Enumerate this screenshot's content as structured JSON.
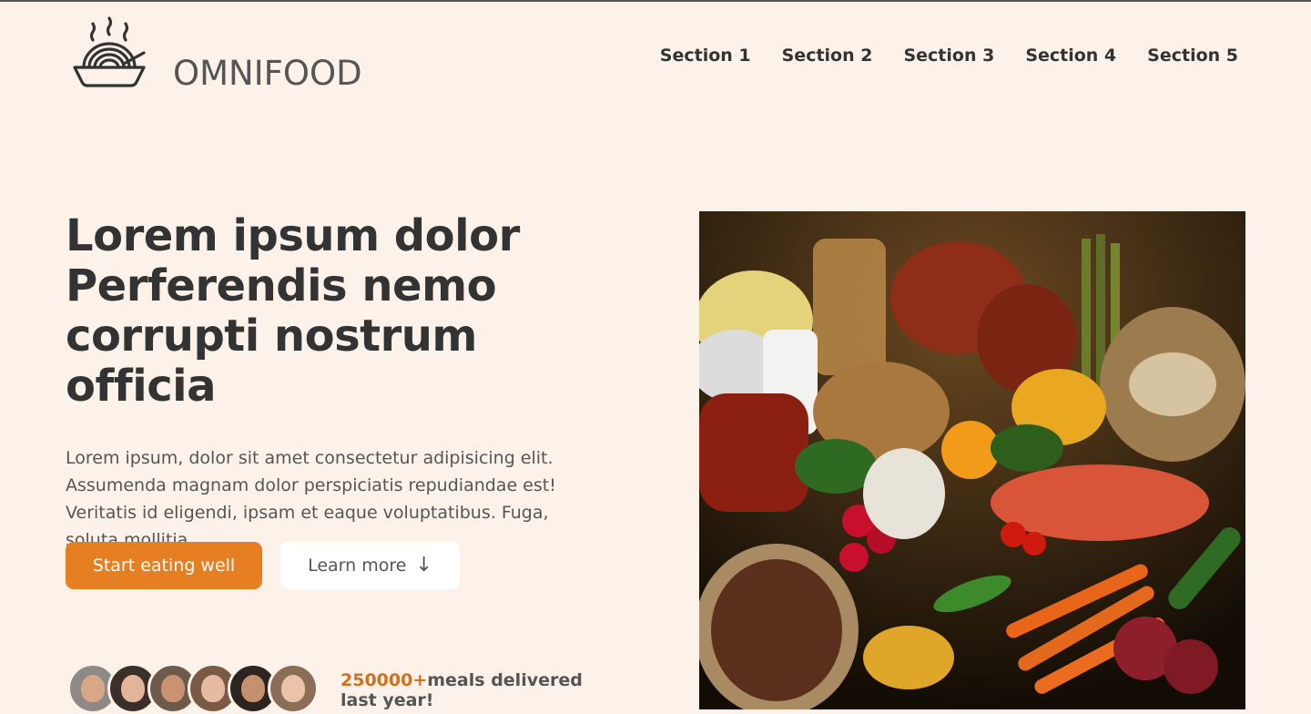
{
  "brand": {
    "name": "OMNIFOOD"
  },
  "nav": {
    "items": [
      "Section 1",
      "Section 2",
      "Section 3",
      "Section 4",
      "Section 5"
    ]
  },
  "hero": {
    "title_lines": [
      "Lorem ipsum dolor",
      "Perferendis nemo",
      "corrupti nostrum officia"
    ],
    "description": "Lorem ipsum, dolor sit amet consectetur adipisicing elit. Assumenda magnam dolor perspiciatis repudiandae est! Veritatis id eligendi, ipsam et eaque voluptatibus. Fuga, soluta mollitia.",
    "cta_primary": "Start eating well",
    "cta_secondary": "Learn more",
    "cta_secondary_icon": "↓"
  },
  "delivered": {
    "count": "250000+",
    "text": "meals delivered last year!"
  },
  "colors": {
    "accent": "#e67e22",
    "background": "#fdf2e9",
    "text": "#333333"
  },
  "icons": [
    "noodle-bowl-logo-icon",
    "arrow-down-icon"
  ]
}
